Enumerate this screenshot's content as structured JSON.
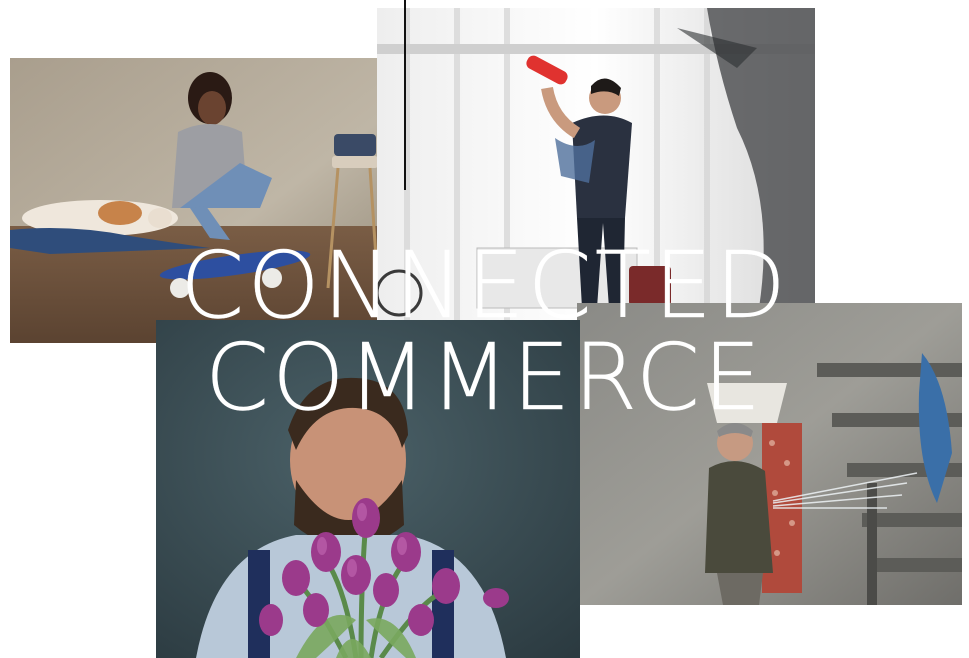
{
  "headline": {
    "line1": "CONNECTED",
    "line2": "COMMERCE"
  },
  "photos": [
    {
      "name": "woman-skateboard-dog"
    },
    {
      "name": "man-drinking-water-bottle"
    },
    {
      "name": "man-with-purple-tulips"
    },
    {
      "name": "man-with-water-spray"
    }
  ],
  "colors": {
    "headline": "#ffffff",
    "background": "#ffffff",
    "accent_red": "#e0322f",
    "tulip_purple": "#9b3a8b"
  }
}
